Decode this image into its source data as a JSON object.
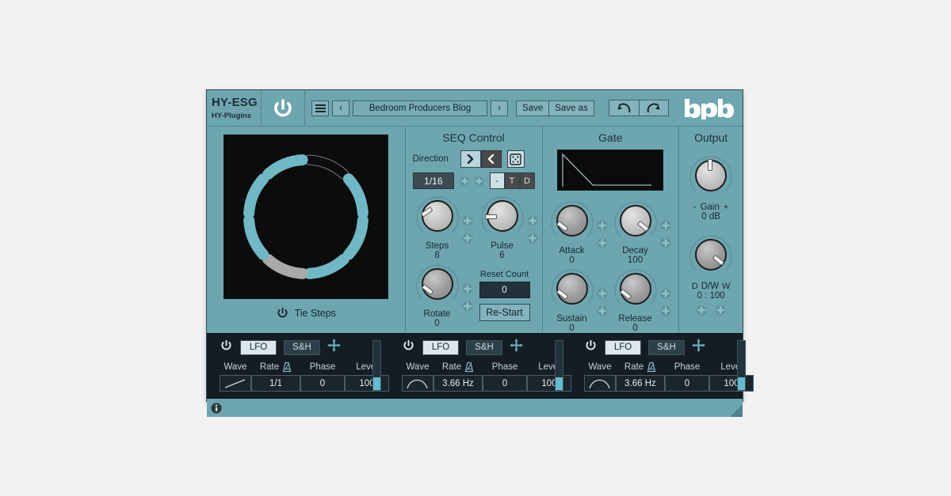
{
  "header": {
    "brand_name": "HY-ESG",
    "brand_sub": "HY-Plugins",
    "power_icon": "power-icon",
    "menu_icon": "hamburger-menu-icon",
    "prev_label": "‹",
    "next_label": "›",
    "preset_name": "Bedroom Producers Blog",
    "save_label": "Save",
    "save_as_label": "Save as",
    "undo_icon": "undo-arrow-icon",
    "redo_icon": "redo-arrow-icon",
    "logo": "bpb"
  },
  "sequencer": {
    "steps_total": 8,
    "segment_states": [
      "off",
      "on",
      "on",
      "on",
      "current",
      "on",
      "on",
      "on"
    ],
    "tie_steps_label": "Tie Steps",
    "tie_steps_icon": "power-icon"
  },
  "seq_control": {
    "title": "SEQ Control",
    "direction_label": "Direction",
    "dir_forward": "❯",
    "dir_backward": "❮",
    "dir_forward_active": true,
    "dir_backward_active": false,
    "random_icon": "dice-icon",
    "rate": "1/16",
    "dot_label": "-",
    "triplet_label": "T",
    "dotted_label": "D",
    "dot_active": true,
    "knobs": [
      {
        "label": "Steps",
        "value": "8",
        "angle": -125
      },
      {
        "label": "Pulse",
        "value": "6",
        "angle": -90
      },
      {
        "label": "Rotate",
        "value": "0",
        "angle": -135
      }
    ],
    "reset_count_label": "Reset Count",
    "reset_count_value": "0",
    "restart_label": "Re-Start",
    "plus_icon": "plus-icon"
  },
  "gate": {
    "title": "Gate",
    "envelope": {
      "attack": 0,
      "decay": 100,
      "sustain": 0,
      "release": 0
    },
    "knobs": [
      {
        "label": "Attack",
        "value": "0",
        "angle": -135
      },
      {
        "label": "Decay",
        "value": "100",
        "angle": 45
      },
      {
        "label": "Sustain",
        "value": "0",
        "angle": -135
      },
      {
        "label": "Release",
        "value": "0",
        "angle": -135
      }
    ],
    "plus_icon": "plus-icon"
  },
  "output": {
    "title": "Output",
    "gain": {
      "label": "Gain",
      "value": "0 dB",
      "min_cap": "-",
      "max_cap": "+",
      "angle": 0
    },
    "drywet": {
      "label": "D/W",
      "value": "0 : 100",
      "min_cap": "D",
      "max_cap": "W",
      "angle": 40
    },
    "plus_icon": "plus-icon"
  },
  "lfos": [
    {
      "power_icon": "power-icon",
      "mode_lfo": "LFO",
      "mode_sh": "S&H",
      "lfo_active": true,
      "move_icon": "move-arrows-icon",
      "head_wave": "Wave",
      "head_rate": "Rate",
      "rate_sync_icon": "metronome-icon",
      "head_phase": "Phase",
      "head_level": "Level",
      "wave_shape": "ramp",
      "rate": "1/1",
      "phase": "0",
      "level": "100",
      "meter_value": 26
    },
    {
      "power_icon": "power-icon",
      "mode_lfo": "LFO",
      "mode_sh": "S&H",
      "lfo_active": true,
      "move_icon": "move-arrows-icon",
      "head_wave": "Wave",
      "head_rate": "Rate",
      "rate_sync_icon": "metronome-icon",
      "head_phase": "Phase",
      "head_level": "Level",
      "wave_shape": "arch",
      "rate": "3.66 Hz",
      "phase": "0",
      "level": "100",
      "meter_value": 26
    },
    {
      "power_icon": "power-icon",
      "mode_lfo": "LFO",
      "mode_sh": "S&H",
      "lfo_active": true,
      "move_icon": "move-arrows-icon",
      "head_wave": "Wave",
      "head_rate": "Rate",
      "rate_sync_icon": "metronome-icon",
      "head_phase": "Phase",
      "head_level": "Level",
      "wave_shape": "arch",
      "rate": "3.66 Hz",
      "phase": "0",
      "level": "100",
      "meter_value": 26
    }
  ],
  "footer": {
    "info_icon": "info-icon",
    "resize_icon": "resize-grip-icon"
  },
  "colors": {
    "body_teal": "#6ea6b0",
    "dark_panel": "#141d24",
    "accent_teal": "#63bdd1",
    "display_black": "#0c0c0c"
  }
}
